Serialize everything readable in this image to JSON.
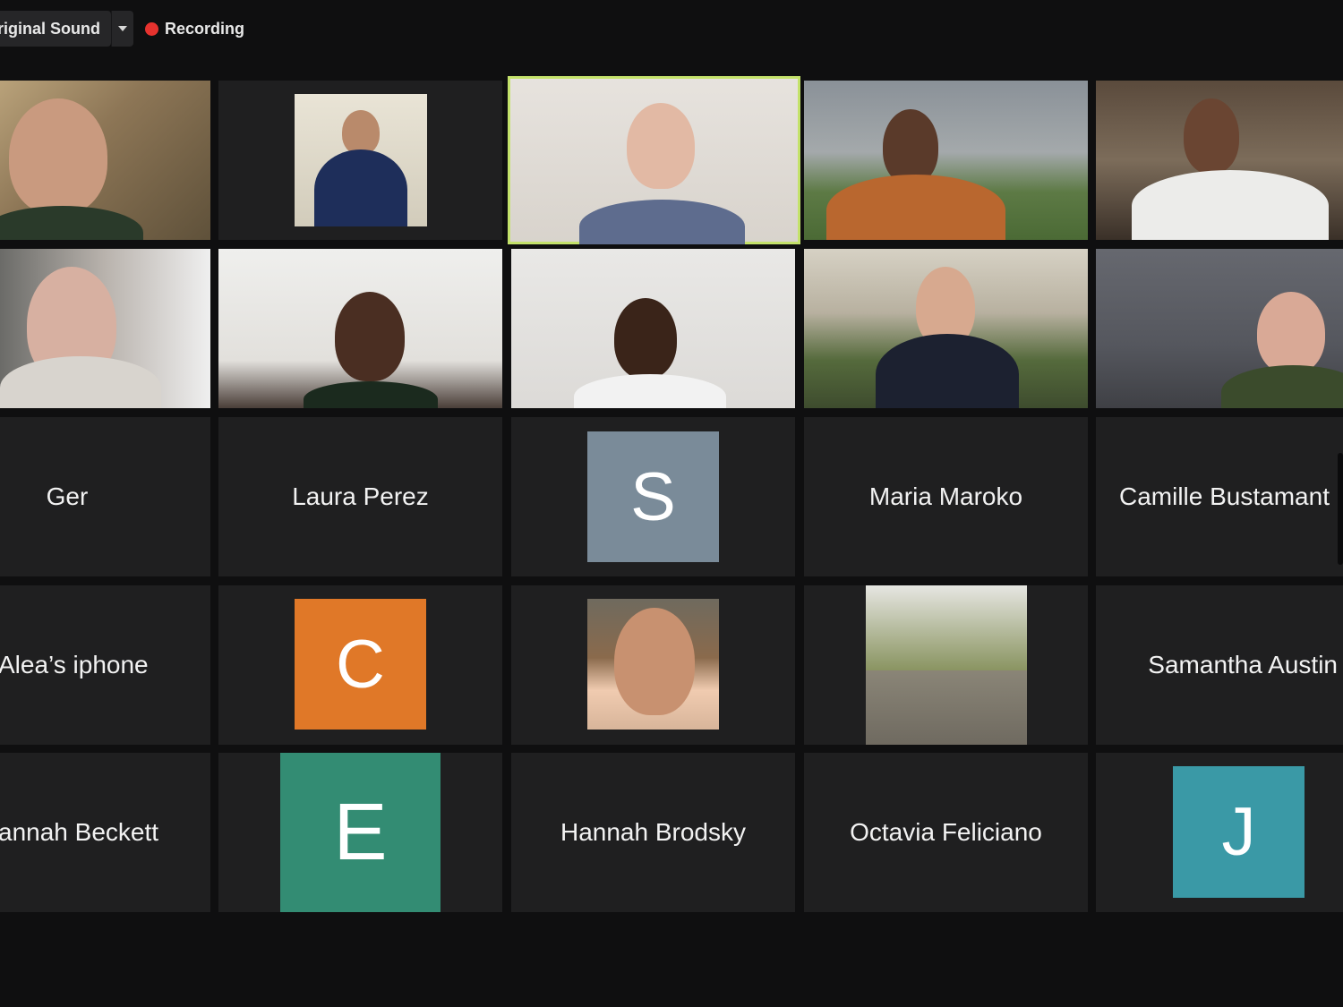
{
  "toolbar": {
    "original_sound_label": "riginal Sound",
    "recording_label": "Recording"
  },
  "colors": {
    "active_speaker_border": "#c4e26b",
    "recording_dot": "#e6322e",
    "avatar_s": "#7a8b99",
    "avatar_c": "#e07828",
    "avatar_e": "#338c73",
    "avatar_j": "#3a99a6"
  },
  "participants": {
    "row3": {
      "c1": "Ger",
      "c2": "Laura Perez",
      "c3_initial": "S",
      "c4": "Maria Maroko",
      "c5": "Camille Bustamant"
    },
    "row4": {
      "c1": "Alea’s iphone",
      "c2_initial": "C",
      "c5": "Samantha Austin"
    },
    "row5": {
      "c1": "annah Beckett",
      "c2_initial": "E",
      "c3": "Hannah Brodsky",
      "c4": "Octavia Feliciano",
      "c5_initial": "J"
    }
  }
}
